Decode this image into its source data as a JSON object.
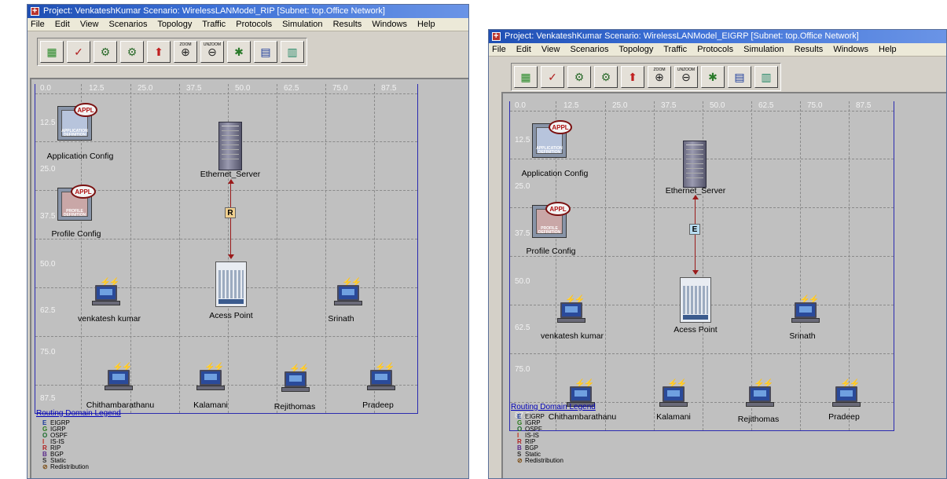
{
  "windows": [
    {
      "title": "Project: VenkateshKumar Scenario: WirelessLANModel_RIP  [Subnet: top.Office Network]",
      "menu": [
        "File",
        "Edit",
        "View",
        "Scenarios",
        "Topology",
        "Traffic",
        "Protocols",
        "Simulation",
        "Results",
        "Windows",
        "Help"
      ],
      "toolbar": [
        {
          "icon": "open-palette-icon"
        },
        {
          "icon": "check-links-icon"
        },
        {
          "icon": "fail-node-icon"
        },
        {
          "icon": "recover-node-icon"
        },
        {
          "icon": "return-to-parent-icon"
        },
        {
          "icon": "zoom-icon",
          "caption": "ZOOM"
        },
        {
          "icon": "unzoom-icon",
          "caption": "UNZOOM"
        },
        {
          "icon": "configure-run-des-icon"
        },
        {
          "icon": "view-results-icon"
        },
        {
          "icon": "hide-graphs-icon"
        }
      ],
      "ticks_x": [
        "0.0",
        "12.5",
        "25.0",
        "37.5",
        "50.0",
        "62.5",
        "75.0",
        "87.5"
      ],
      "ticks_y": [
        "12.5",
        "25.0",
        "37.5",
        "50.0",
        "62.5",
        "75.0",
        "87.5"
      ],
      "nodes": {
        "app_config": {
          "label": "Application Config",
          "badge": "APPL",
          "caption": "APPLICATION DEFINITION"
        },
        "profile_config": {
          "label": "Profile Config",
          "badge": "APPL",
          "caption": "PROFILE DEFINITION"
        },
        "server": {
          "label": "Ethernet_Server"
        },
        "access_point": {
          "label": "Acess Point"
        },
        "venkatesh": {
          "label": "venkatesh kumar"
        },
        "srinath": {
          "label": "Srinath"
        },
        "chithambarathanu": {
          "label": "Chithambarathanu"
        },
        "kalamani": {
          "label": "Kalamani"
        },
        "rejithomas": {
          "label": "Rejithomas"
        },
        "pradeep": {
          "label": "Pradeep"
        }
      },
      "routing_badge": "R",
      "routing_badge_color": "#f0d090"
    },
    {
      "title": "Project: VenkateshKumar Scenario: WirelessLANModel_EIGRP  [Subnet: top.Office Network]",
      "menu": [
        "File",
        "Edit",
        "View",
        "Scenarios",
        "Topology",
        "Traffic",
        "Protocols",
        "Simulation",
        "Results",
        "Windows",
        "Help"
      ],
      "toolbar": [
        {
          "icon": "open-palette-icon"
        },
        {
          "icon": "check-links-icon"
        },
        {
          "icon": "fail-node-icon"
        },
        {
          "icon": "recover-node-icon"
        },
        {
          "icon": "return-to-parent-icon"
        },
        {
          "icon": "zoom-icon",
          "caption": "ZOOM"
        },
        {
          "icon": "unzoom-icon",
          "caption": "UNZOOM"
        },
        {
          "icon": "configure-run-des-icon"
        },
        {
          "icon": "view-results-icon"
        },
        {
          "icon": "hide-graphs-icon"
        }
      ],
      "ticks_x": [
        "0.0",
        "12.5",
        "25.0",
        "37.5",
        "50.0",
        "62.5",
        "75.0",
        "87.5"
      ],
      "ticks_y": [
        "12.5",
        "25.0",
        "37.5",
        "50.0",
        "62.5",
        "75.0",
        "87.5"
      ],
      "nodes": {
        "app_config": {
          "label": "Application Config",
          "badge": "APPL",
          "caption": "APPLICATION DEFINITION"
        },
        "profile_config": {
          "label": "Profile Config",
          "badge": "APPL",
          "caption": "PROFILE DEFINITION"
        },
        "server": {
          "label": "Ethernet_Server"
        },
        "access_point": {
          "label": "Acess Point"
        },
        "venkatesh": {
          "label": "venkatesh kumar"
        },
        "srinath": {
          "label": "Srinath"
        },
        "chithambarathanu": {
          "label": "Chithambarathanu"
        },
        "kalamani": {
          "label": "Kalamani"
        },
        "rejithomas": {
          "label": "Rejithomas"
        },
        "pradeep": {
          "label": "Pradeep"
        }
      },
      "routing_badge": "E",
      "routing_badge_color": "#b8dcf0"
    }
  ],
  "legend": {
    "title": "Routing Domain Legend",
    "entries": [
      {
        "abbr": "E",
        "name": "EIGRP",
        "color": "#1a3a9a"
      },
      {
        "abbr": "G",
        "name": "IGRP",
        "color": "#2a7a1a"
      },
      {
        "abbr": "O",
        "name": "OSPF",
        "color": "#1a6a2a"
      },
      {
        "abbr": "I",
        "name": "IS-IS",
        "color": "#c03020"
      },
      {
        "abbr": "R",
        "name": "RIP",
        "color": "#b02020"
      },
      {
        "abbr": "B",
        "name": "BGP",
        "color": "#5a2a8a"
      },
      {
        "abbr": "S",
        "name": "Static",
        "color": "#303030"
      },
      {
        "abbr": "⊘",
        "name": "Redistribution",
        "color": "#7a4a10"
      }
    ]
  }
}
